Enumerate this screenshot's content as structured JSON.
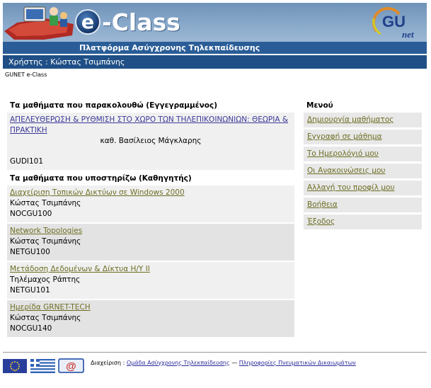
{
  "header": {
    "logo_text": "e-Class",
    "logo_e": "e",
    "logo_word": "-Class",
    "subtitle": "Πλατφόρμα Ασύγχρονης Τηλεκπαίδευσης",
    "gunet_logo_text": "GUnet"
  },
  "userbar": {
    "text": "Χρήστης : Κώστας Τσιμπάνης"
  },
  "breadcrumb": {
    "text": "GUNET e-Class"
  },
  "enrolled": {
    "title": "Τα μαθήματα που παρακολουθώ (Εγγεγραμμένος)",
    "courses": [
      {
        "name": "ΑΠΕΛΕΥΘΕΡΩΣΗ & ΡΥΘΜΙΣΗ ΣΤΟ ΧΩΡΟ ΤΩΝ ΤΗΛΕΠΙΚΟΙΝΩΝΙΩΝ: ΘΕΩΡΙΑ & ΠΡΑΚΤΙΚΗ",
        "instructor": "καθ. Βασίλειος Μάγκλαρης",
        "code": "GUDI101"
      }
    ]
  },
  "teaching": {
    "title": "Τα μαθήματα που υποστηρίζω (Καθηγητής)",
    "courses": [
      {
        "name": "Διαχείριση Τοπικών Δικτύων σε Windows 2000",
        "instructor": "Κώστας Τσιμπάνης",
        "code": "NOCGU100"
      },
      {
        "name": "Network Topologies",
        "instructor": "Κώστας Τσιμπάνης",
        "code": "NETGU100"
      },
      {
        "name": "Μετάδοση Δεδομένων & Δίκτυα Η/Υ ΙΙ",
        "instructor": "Τηλέμαχος Ράπτης",
        "code": "NETGU101"
      },
      {
        "name": "Ημερίδα GRNET-TECH",
        "instructor": "Κώστας Τσιμπάνης",
        "code": "NOCGU140"
      }
    ]
  },
  "menu": {
    "title": "Μενού",
    "items": [
      {
        "label": "Δημιουργία μαθήματος"
      },
      {
        "label": "Εγγραφή σε μάθημα"
      },
      {
        "label": "Το Ημερολόγιό μου"
      },
      {
        "label": "Οι Ανακοινώσεις μου"
      },
      {
        "label": "Αλλαγή του προφίλ μου"
      },
      {
        "label": "Βοήθεια"
      },
      {
        "label": "Έξοδος"
      }
    ]
  },
  "footer": {
    "admin_label": "Διαχείριση : ",
    "admin_link": "Ομάδα Ασύγχρονης Τηλεκπαίδευσης",
    "separator": " — ",
    "rights_link": "Πληροφορίες Πνευματικών Δικαιωμάτων",
    "email_badge": "@"
  },
  "colors": {
    "header_bar": "#2a5d97",
    "userbar": "#1f4f86",
    "link_blue": "#3a3a99",
    "link_olive": "#6d6d24",
    "row_light": "#f0f0f0",
    "row_dark": "#e3e3e3"
  }
}
